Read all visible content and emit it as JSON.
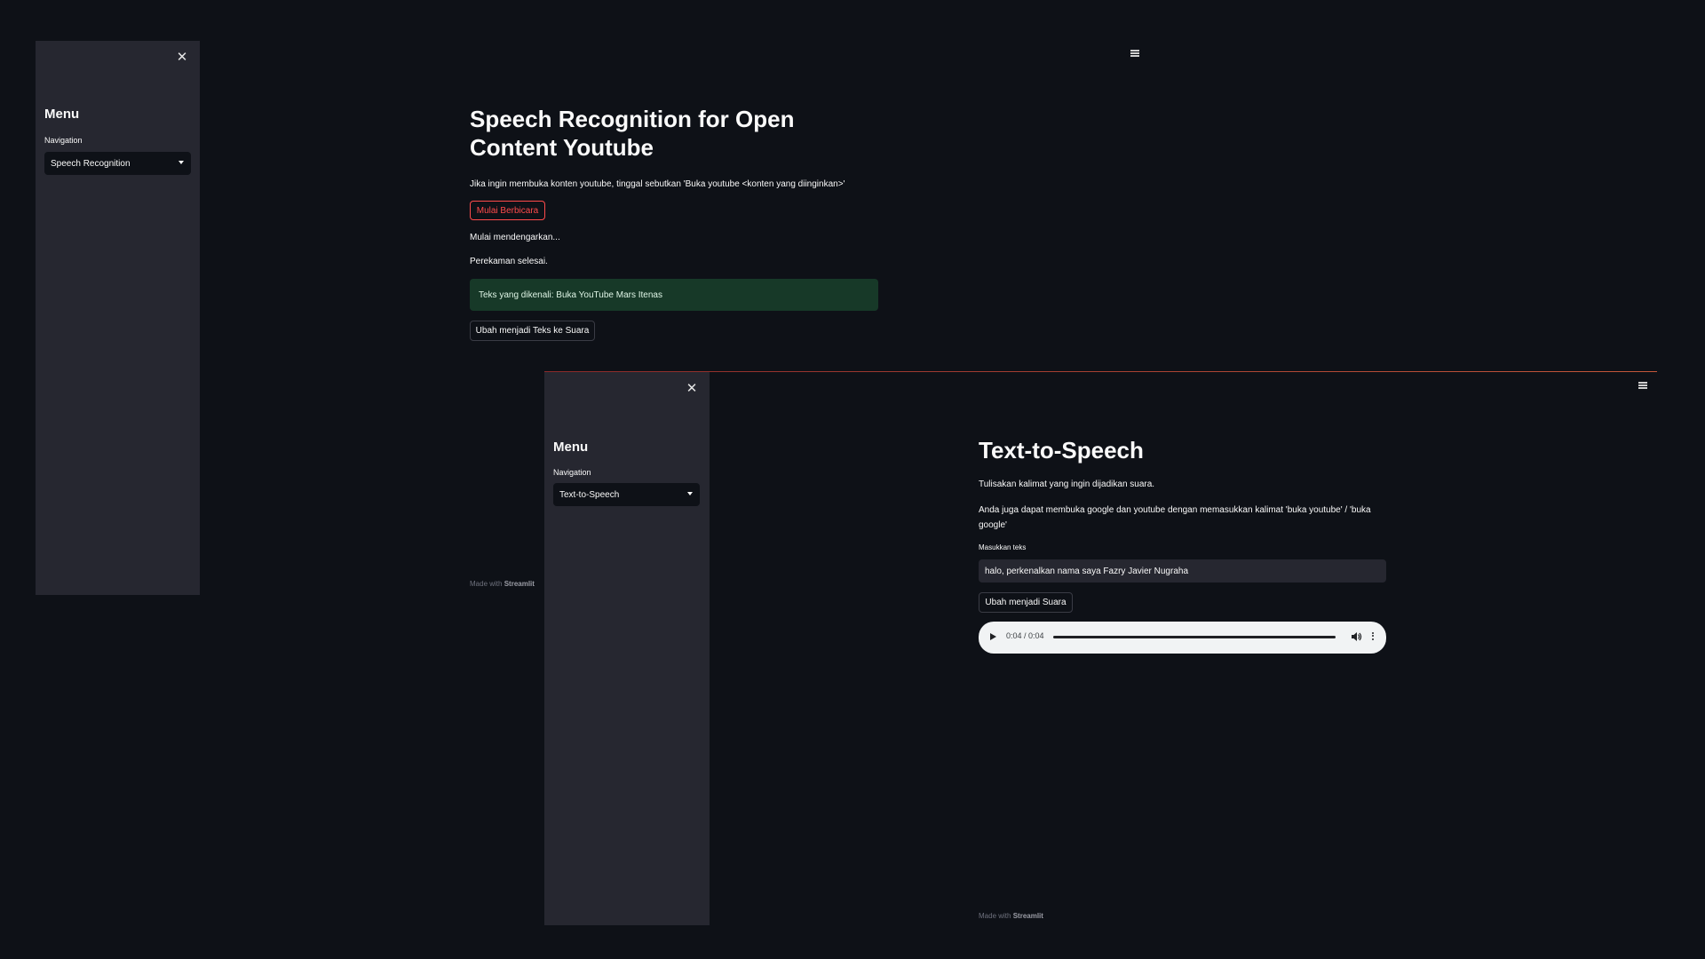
{
  "window1": {
    "sidebar": {
      "close_icon": "close-icon",
      "menu_title": "Menu",
      "nav_label": "Navigation",
      "nav_selected": "Speech Recognition"
    },
    "main_menu_icon": "hamburger-menu-icon",
    "title_line1": "Speech Recognition for Open",
    "title_line2": "Content Youtube",
    "instruction": "Jika ingin membuka konten youtube, tinggal sebutkan 'Buka youtube <konten yang diinginkan>'",
    "start_button": "Mulai Berbicara",
    "status_listening": "Mulai mendengarkan...",
    "status_done": "Perekaman selesai.",
    "recognized_text": "Teks yang dikenali: Buka YouTube Mars Itenas",
    "convert_button": "Ubah menjadi Teks ke Suara",
    "footer_prefix": "Made with",
    "footer_brand": "Streamlit"
  },
  "window2": {
    "sidebar": {
      "close_icon": "close-icon",
      "menu_title": "Menu",
      "nav_label": "Navigation",
      "nav_selected": "Text-to-Speech"
    },
    "main_menu_icon": "hamburger-menu-icon",
    "title": "Text-to-Speech",
    "desc1": "Tulisakan kalimat yang ingin dijadikan suara.",
    "desc2_line1": "Anda juga dapat membuka google dan youtube dengan memasukkan kalimat 'buka youtube' / 'buka",
    "desc2_line2": "google'",
    "input_label": "Masukkan teks",
    "input_value": "halo, perkenalkan nama saya Fazry Javier Nugraha",
    "convert_button": "Ubah menjadi Suara",
    "audio": {
      "time": "0:04 / 0:04",
      "progress": 1.0,
      "play_icon": "play-icon",
      "volume_icon": "volume-icon",
      "more_icon": "more-options-icon"
    },
    "footer_prefix": "Made with",
    "footer_brand": "Streamlit"
  },
  "colors": {
    "background": "#0e1117",
    "sidebar": "#262730",
    "accent_red": "#ff4b4b",
    "success_bg": "#173928",
    "text": "#fafafa"
  }
}
